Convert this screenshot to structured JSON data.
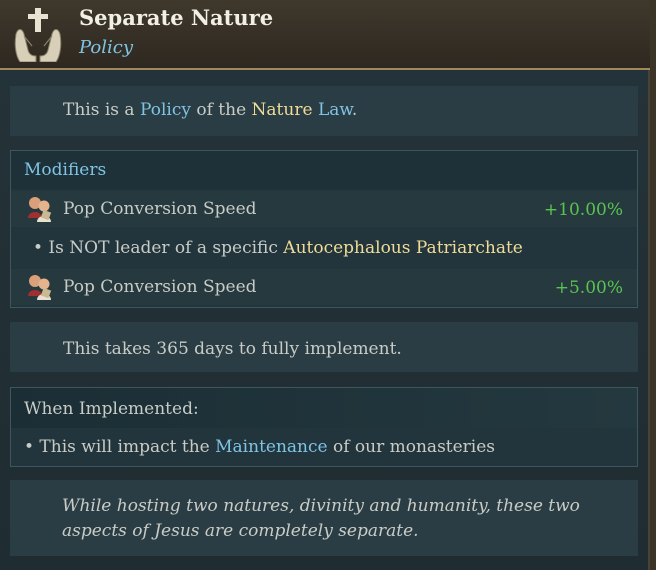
{
  "header": {
    "title": "Separate Nature",
    "subtitle": "Policy",
    "icon": "praying-hands-cross-icon"
  },
  "intro": {
    "prefix": "This is a ",
    "policy_word": "Policy",
    "middle": " of the ",
    "law_name": "Nature",
    "space": " ",
    "law_word": "Law",
    "suffix": "."
  },
  "modifiers": {
    "header": "Modifiers",
    "rows": [
      {
        "icon": "pop-conversion-icon",
        "label": "Pop Conversion Speed",
        "value": "+10.00%"
      },
      {
        "bullet": "• Is NOT leader of a specific ",
        "highlight": "Autocephalous Patriarchate"
      },
      {
        "icon": "pop-conversion-icon",
        "label": "Pop Conversion Speed",
        "value": "+5.00%"
      }
    ]
  },
  "implement_time": "This takes 365 days to fully implement.",
  "when_implemented": {
    "header": "When Implemented:",
    "prefix": "• This will impact the ",
    "highlight": "Maintenance",
    "suffix": " of our monasteries"
  },
  "flavor": "While hosting two natures, divinity and humanity, these two aspects of Jesus are completely separate.",
  "colors": {
    "link_blue": "#7fc4e4",
    "gold": "#f0dc98",
    "positive_green": "#59c44f"
  }
}
